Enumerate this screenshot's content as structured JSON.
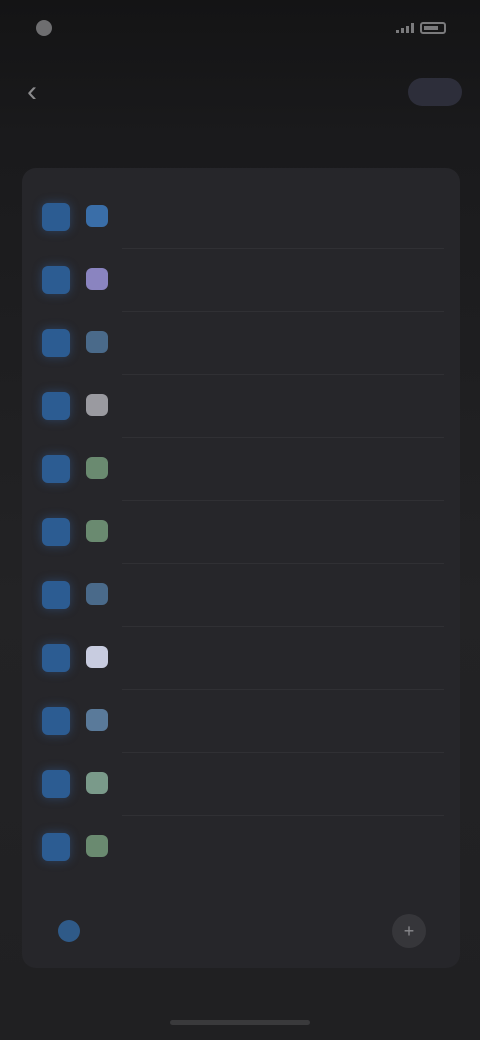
{
  "status_bar": {
    "time": "",
    "right_text": ""
  },
  "header": {
    "title": "",
    "action_label": ""
  },
  "list": {
    "items": [
      {
        "label": "",
        "icon": "app-icon",
        "color": "#3a6ea8"
      },
      {
        "label": "",
        "icon": "app-icon",
        "color": "#8a84c0"
      },
      {
        "label": "",
        "icon": "app-icon",
        "color": "#4a6a8a"
      },
      {
        "label": "",
        "icon": "app-icon",
        "color": "#9a9aa0"
      },
      {
        "label": "",
        "icon": "app-icon",
        "color": "#6a8a70"
      },
      {
        "label": "",
        "icon": "app-icon",
        "color": "#6a8a70"
      },
      {
        "label": "",
        "icon": "app-icon",
        "color": "#4a6a8a"
      },
      {
        "label": "",
        "icon": "app-icon",
        "color": "#c8cce0"
      },
      {
        "label": "",
        "icon": "app-icon",
        "color": "#5a7a9a"
      },
      {
        "label": "",
        "icon": "app-icon",
        "color": "#7a9a8a"
      },
      {
        "label": "",
        "icon": "app-icon",
        "color": "#6a8a70"
      }
    ]
  },
  "footer": {
    "label": ""
  },
  "colors": {
    "background": "#1d1d1f",
    "panel": "#26262a",
    "checkbox": "#2c5c92",
    "title": "#d6d0b8"
  }
}
